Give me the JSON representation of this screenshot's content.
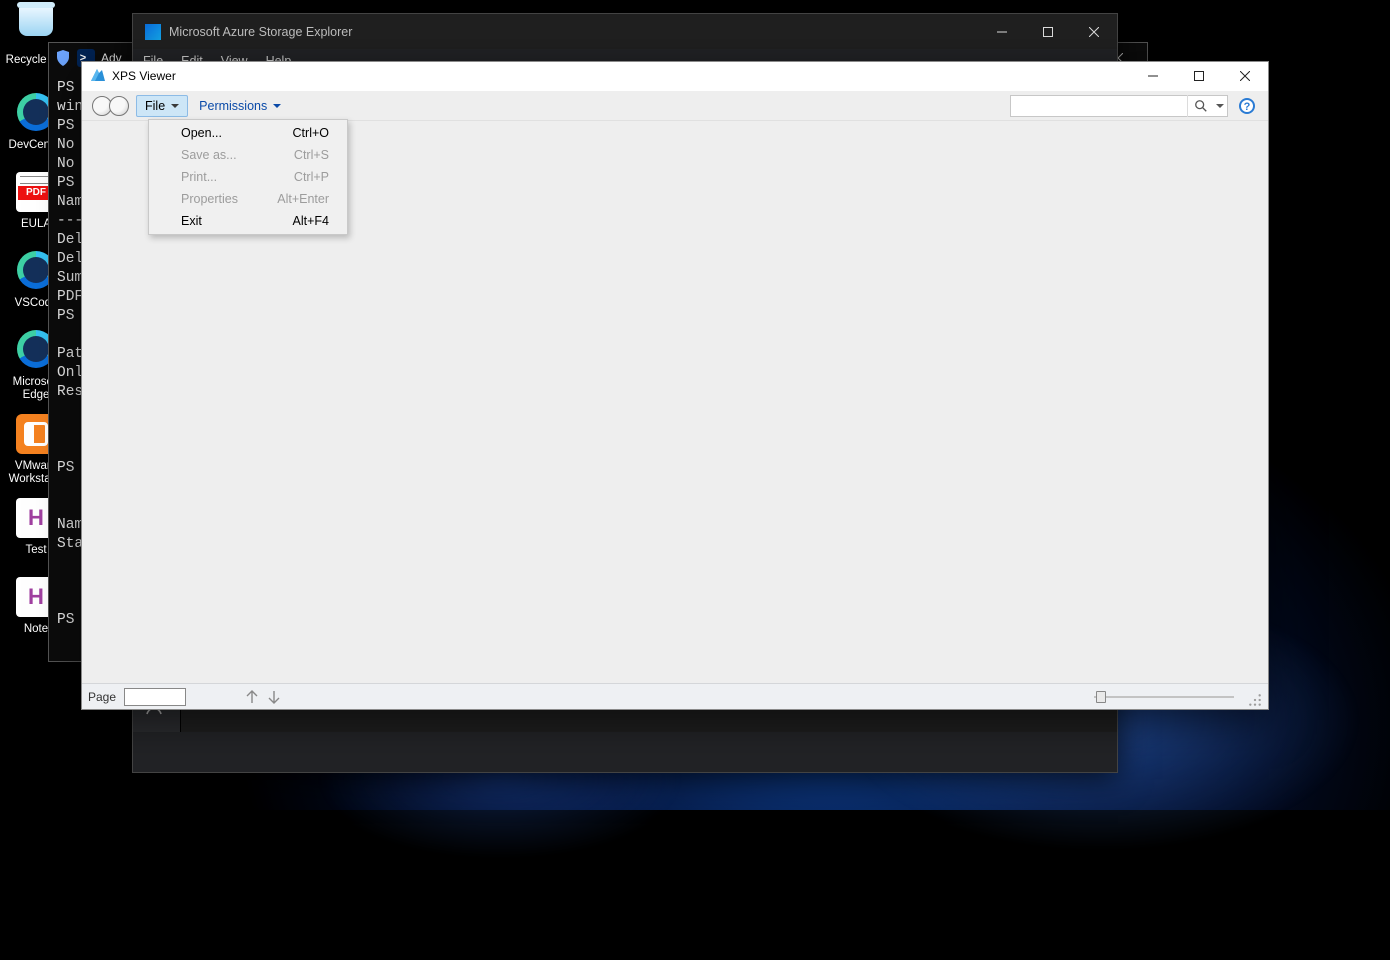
{
  "desktop": {
    "icons": [
      {
        "label": "Recycle Bin"
      },
      {
        "label": "DevCenter"
      },
      {
        "label": "EULA"
      },
      {
        "label": "VSCode"
      },
      {
        "label": "Microsoft Edge"
      },
      {
        "label": "VMware Workstat..."
      },
      {
        "label": "Test"
      },
      {
        "label": "Note"
      }
    ]
  },
  "azure": {
    "title": "Microsoft Azure Storage Explorer",
    "menus": [
      "File",
      "Edit",
      "View",
      "Help"
    ],
    "adv": "Adv"
  },
  "powershell": {
    "lines": [
      "PS",
      "win",
      "PS",
      "No",
      "No",
      "PS",
      "Nam",
      "---",
      "Del",
      "Del",
      "Sum",
      "PDF",
      "PS",
      "",
      "Pat",
      "Onl",
      "Res",
      "",
      "",
      "",
      "PS",
      "",
      "",
      "Nam",
      "Sta",
      "",
      "",
      "",
      "PS"
    ]
  },
  "xps": {
    "title": "XPS Viewer",
    "toolbar": {
      "file": "File",
      "permissions": "Permissions"
    },
    "file_menu": [
      {
        "label": "Open...",
        "accel": "Ctrl+O",
        "enabled": true
      },
      {
        "label": "Save as...",
        "accel": "Ctrl+S",
        "enabled": false
      },
      {
        "label": "Print...",
        "accel": "Ctrl+P",
        "enabled": false
      },
      {
        "label": "Properties",
        "accel": "Alt+Enter",
        "enabled": false
      },
      {
        "label": "Exit",
        "accel": "Alt+F4",
        "enabled": true
      }
    ],
    "search_placeholder": "",
    "status": {
      "page_label": "Page"
    }
  }
}
